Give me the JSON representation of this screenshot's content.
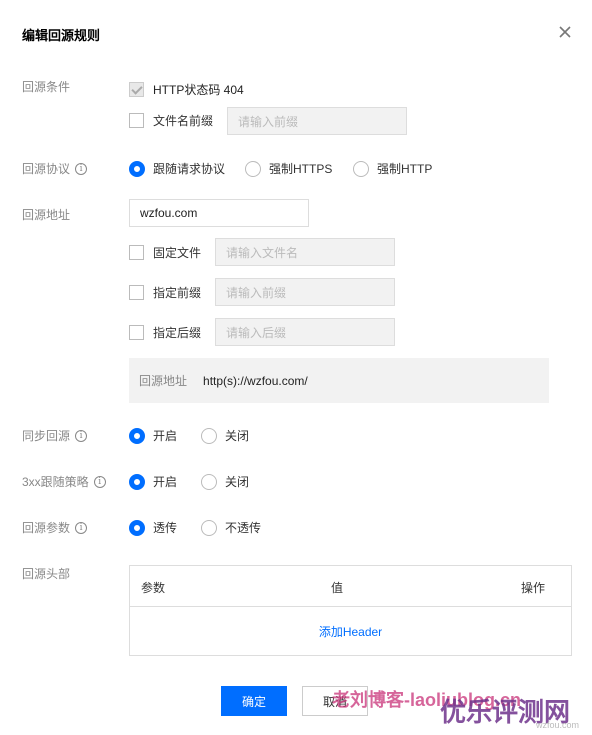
{
  "dialog": {
    "title": "编辑回源规则"
  },
  "condition": {
    "label": "回源条件",
    "http404_label": "HTTP状态码 404",
    "prefix_label": "文件名前缀",
    "prefix_placeholder": "请输入前缀"
  },
  "protocol": {
    "label": "回源协议",
    "options": [
      "跟随请求协议",
      "强制HTTPS",
      "强制HTTP"
    ],
    "selected": "跟随请求协议"
  },
  "address": {
    "label": "回源地址",
    "value": "wzfou.com",
    "fixed_file_label": "固定文件",
    "fixed_file_placeholder": "请输入文件名",
    "prefix_label": "指定前缀",
    "prefix_placeholder": "请输入前缀",
    "suffix_label": "指定后缀",
    "suffix_placeholder": "请输入后缀",
    "preview_label": "回源地址",
    "preview_value": "http(s)://wzfou.com/"
  },
  "sync": {
    "label": "同步回源",
    "on": "开启",
    "off": "关闭",
    "selected": "开启"
  },
  "redirect": {
    "label": "3xx跟随策略",
    "on": "开启",
    "off": "关闭",
    "selected": "开启"
  },
  "params": {
    "label": "回源参数",
    "on": "透传",
    "off": "不透传",
    "selected": "透传"
  },
  "headers": {
    "label": "回源头部",
    "columns": [
      "参数",
      "值",
      "操作"
    ],
    "add_link": "添加Header"
  },
  "footer": {
    "confirm": "确定",
    "cancel": "取消"
  },
  "watermark": {
    "text1": "老刘博客-laoliublog.cn",
    "text2": "优乐评测网",
    "text3": "wzfou.com"
  },
  "colors": {
    "accent": "#006eff",
    "muted": "#888888"
  },
  "icons": {
    "close": "close-icon",
    "info": "info-icon"
  }
}
